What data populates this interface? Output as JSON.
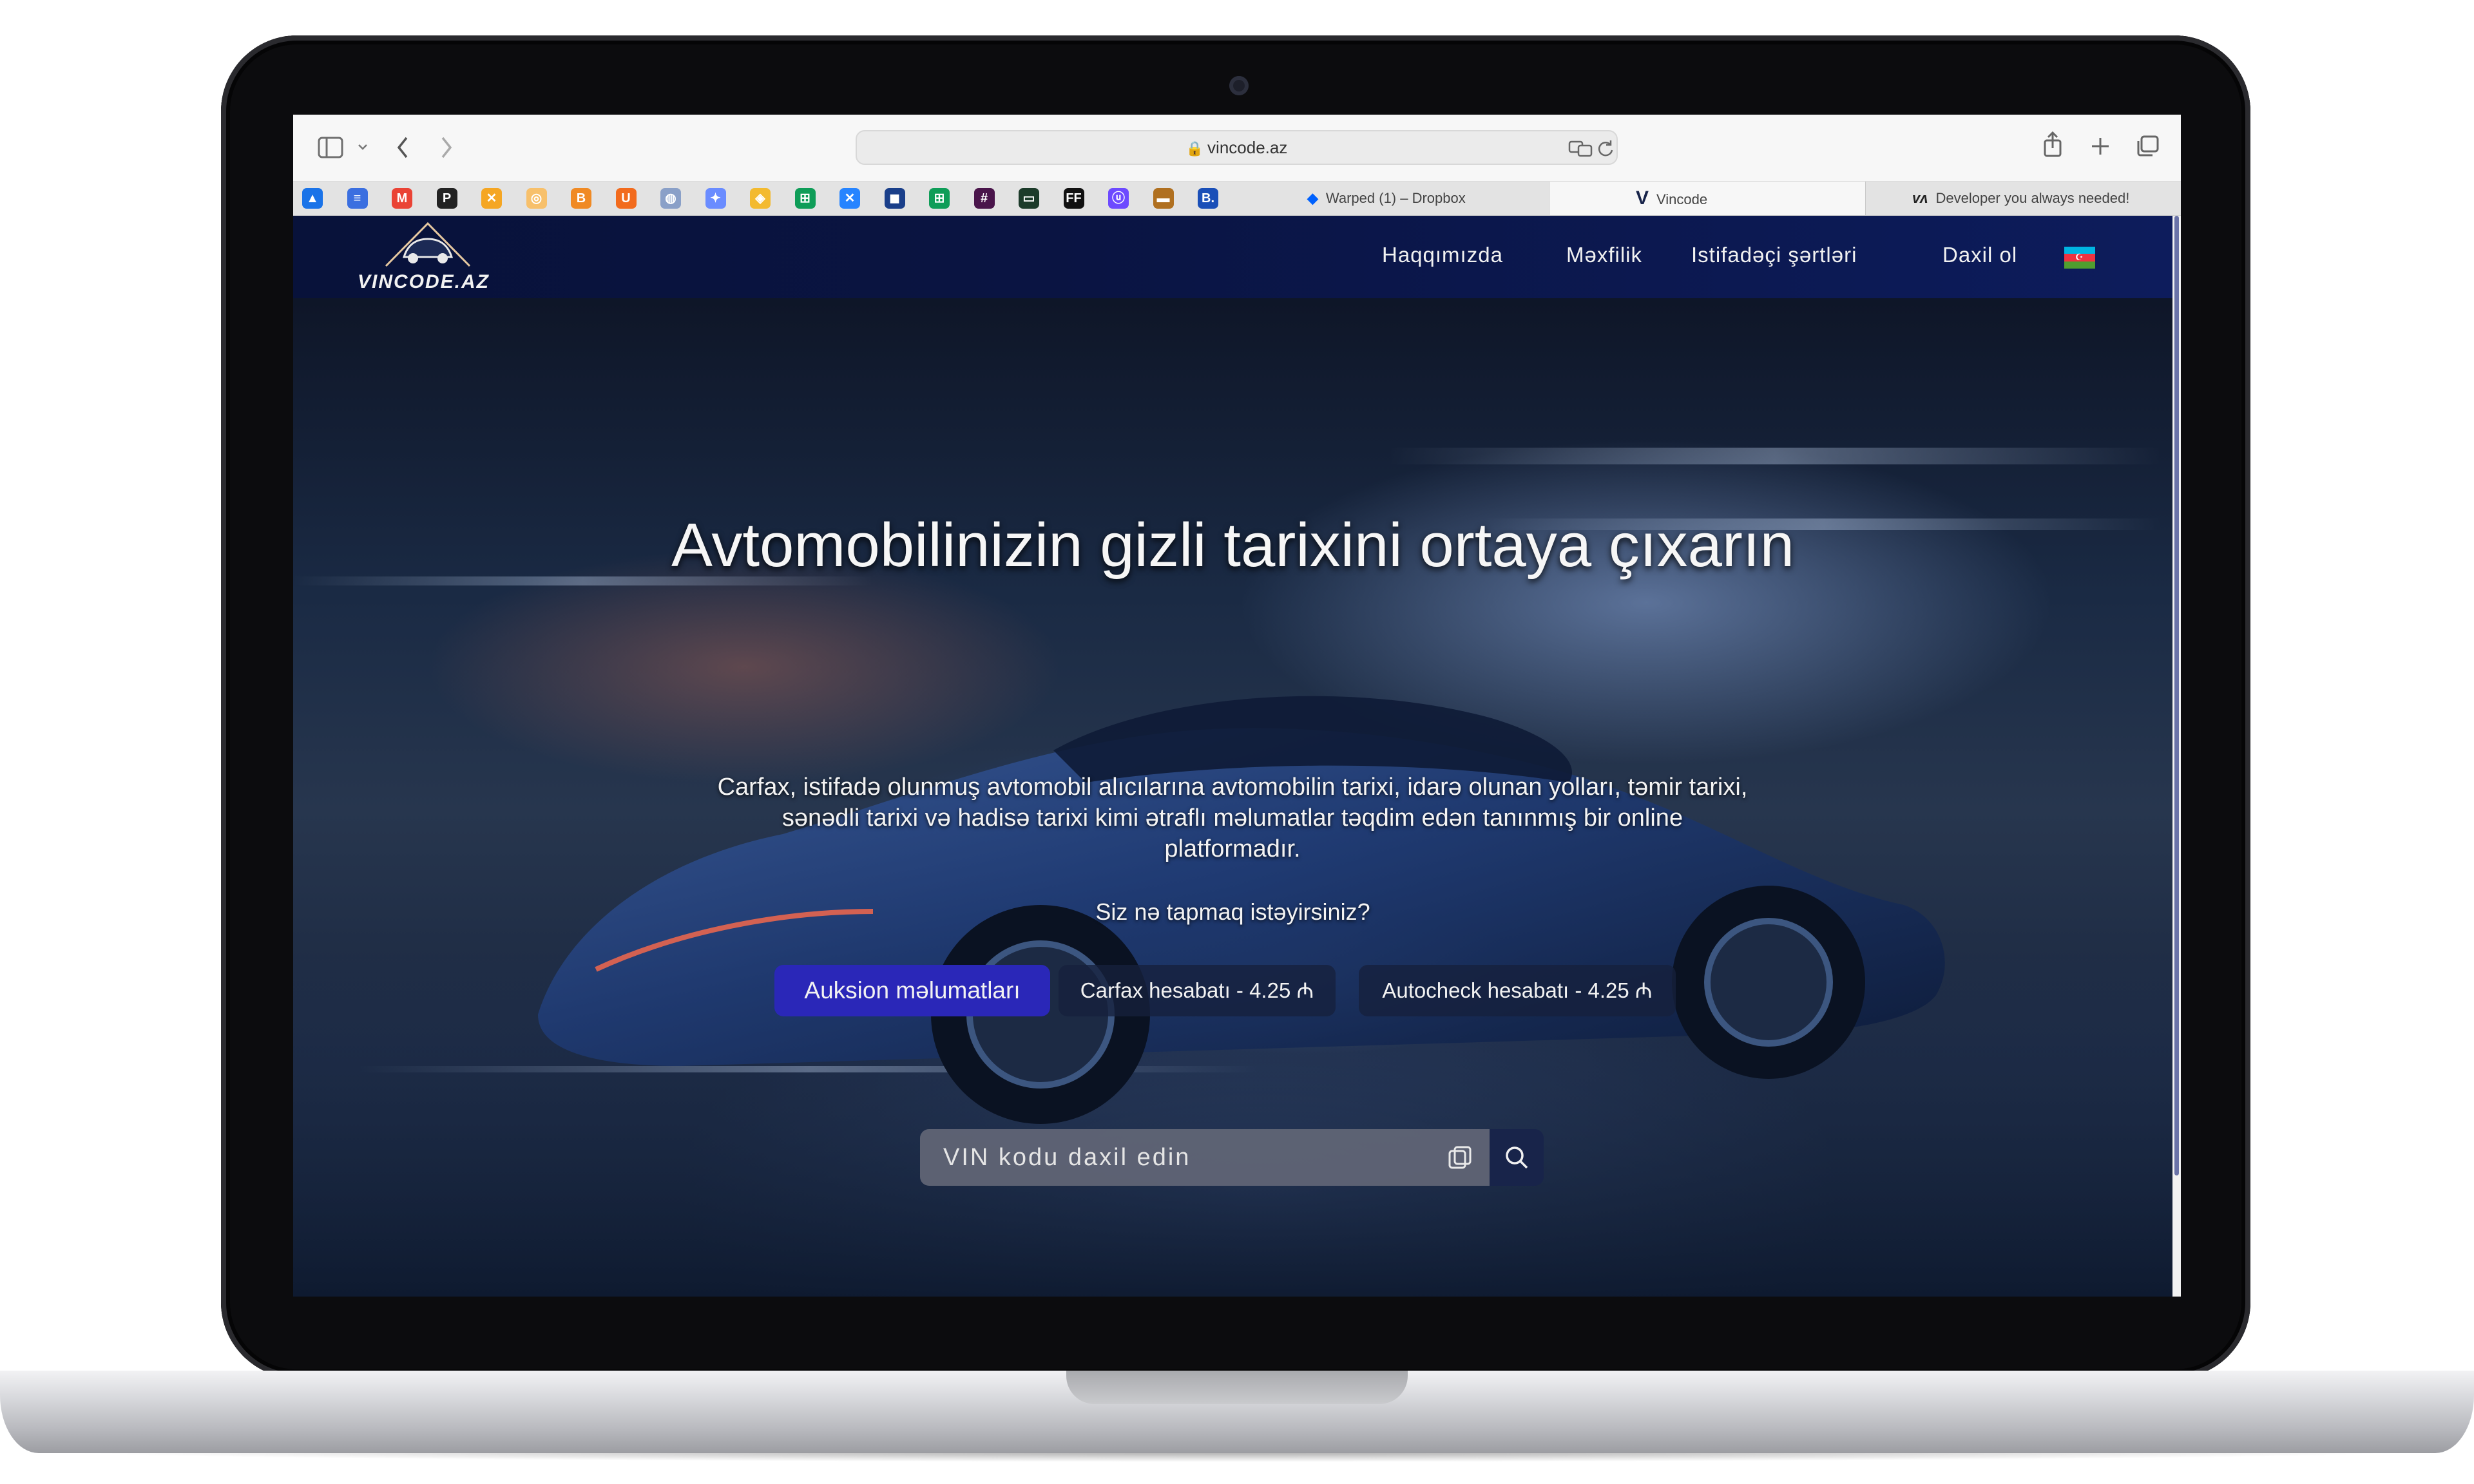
{
  "browser": {
    "url": "vincode.az",
    "tabs": [
      {
        "label": "Warped (1) – Dropbox",
        "active": false
      },
      {
        "label": "Vincode",
        "active": true
      },
      {
        "label": "Developer you always needed!",
        "active": false
      }
    ],
    "bookmark_icons": [
      "google-drive-icon",
      "forms-icon",
      "gmail-icon",
      "pinterest-icon",
      "x-icon",
      "crypto-icon",
      "orange-app-icon",
      "u-app-icon",
      "openai-icon",
      "gemini-icon",
      "binance-icon",
      "sheets-icon",
      "jira-icon",
      "sharepoint-icon",
      "sheets-2-icon",
      "slack-icon",
      "terminal-icon",
      "ff-icon",
      "proton-icon",
      "flag-bookmark-icon",
      "booking-icon"
    ]
  },
  "site": {
    "logo_text": "VINCODE.AZ",
    "nav": [
      "Haqqımızda",
      "Məxfilik",
      "Istifadəçi şərtləri",
      "Daxil ol"
    ],
    "language_flag": {
      "colors": [
        "#00b5e2",
        "#ef3340",
        "#509e2f"
      ]
    },
    "hero_title": "Avtomobilinizin gizli tarixini ortaya çıxarın",
    "hero_description": "Carfax, istifadə olunmuş avtomobil alıcılarına avtomobilin tarixi, idarə olunan yolları, təmir tarixi, sənədli tarixi və hadisə tarixi kimi ətraflı məlumatlar təqdim edən tanınmış bir online platformadır.",
    "question": "Siz nə tapmaq istəyirsiniz?",
    "options": [
      {
        "label": "Auksion məlumatları",
        "selected": true
      },
      {
        "label": "Carfax hesabatı - 4.25 ₼",
        "selected": false
      },
      {
        "label": "Autocheck hesabatı - 4.25 ₼",
        "selected": false
      }
    ],
    "search_placeholder": "VIN kodu daxil edin"
  },
  "colors": {
    "nav_bg": "#0a1442",
    "primary_button": "#2a27b8",
    "search_button": "#18244a"
  }
}
